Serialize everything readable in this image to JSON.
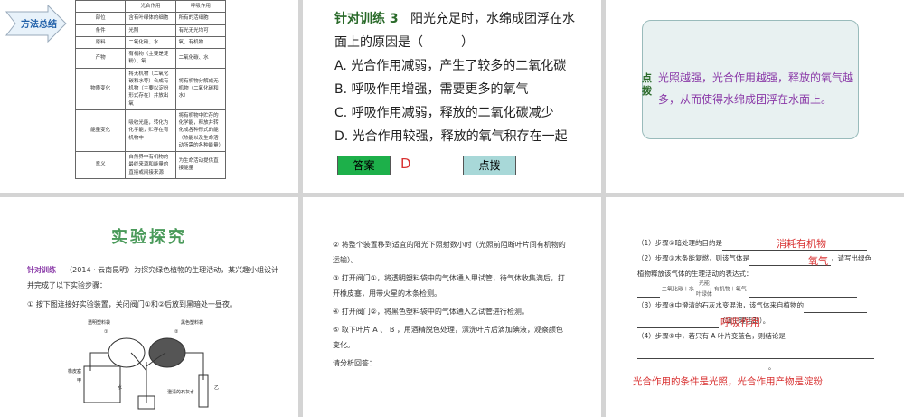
{
  "slide1": {
    "badge": "方法总结",
    "table": {
      "headers": [
        "",
        "光合作用",
        "呼吸作用"
      ],
      "rows": [
        [
          "部位",
          "含有叶绿体的细胞",
          "所有的活细胞"
        ],
        [
          "条件",
          "光照",
          "有光无光均可"
        ],
        [
          "原料",
          "二氧化碳、水",
          "氧、有机物"
        ],
        [
          "产物",
          "有机物（主要是淀粉）、氧",
          "二氧化碳、水"
        ],
        [
          "物质变化",
          "将无机物（二氧化碳和水等）合成有机物（主要以淀粉形式存在）并放出氧",
          "将有机物分解成无机物（二氧化碳和水）"
        ],
        [
          "能量变化",
          "吸收光能，转化为化学能，贮存在有机物中",
          "将有机物中贮存的化学能，释放并转化成各种形式的能（热能以及生命活动所需的各种能量）"
        ],
        [
          "意义",
          "自然界中有机物的最终来源和能量的直接或间接来源",
          "为生命活动提供直接能量"
        ]
      ]
    }
  },
  "slide2": {
    "label": "针对训练 3",
    "question": "阳光充足时，水绵成团浮在水面上的原因是（　　　）",
    "options": [
      "A. 光合作用减弱，产生了较多的二氧化碳",
      "B. 呼吸作用增强，需要更多的氧气",
      "C. 呼吸作用减弱，释放的二氧化碳减少",
      "D. 光合作用较强，释放的氧气积存在一起"
    ],
    "answer_btn": "答案",
    "answer": "D",
    "hint_btn": "点拨",
    "colors": {
      "answer_btn": "#1db04a",
      "hint_btn": "#a8d8d8",
      "answer": "#d83030"
    }
  },
  "slide3": {
    "label": "点拨",
    "text": "光照越强，光合作用越强，释放的氧气越多，从而使得水绵成团浮在水面上。"
  },
  "slide4": {
    "title": "实验探究",
    "label": "针对训练",
    "source": "（2014 · 云南昆明）为探究绿色植物的生理活动，某兴趣小组设计并完成了以下实验步骤：",
    "step1": "① 按下图连接好实验装置，关闭阀门①和②后放到黑暗处一昼夜。",
    "diagram": {
      "bag1": "透明塑料袋",
      "bag2": "黑色塑料袋",
      "stopper": "橡皮塞",
      "jia": "甲",
      "water": "水",
      "limewater": "澄清的石灰水",
      "yi": "乙",
      "valve1": "①",
      "valve2": "②"
    }
  },
  "slide5": {
    "lines": [
      "② 将整个装置移到适宜的阳光下照射数小时（光照前阻断叶片间有机物的运输）。",
      "③ 打开阀门①，将透明塑料袋中的气体通入甲试管，待气体收集满后，打开橡皮塞，用带火星的木条检测。",
      "④ 打开阀门②，将黑色塑料袋中的气体通入乙试管进行检测。",
      "⑤ 取下叶片 A 、 B ，用酒精脱色处理，漂洗叶片后滴加碘液，观察颜色变化。",
      "请分析回答："
    ]
  },
  "slide6": {
    "q1": "（1）步骤①暗处理的目的是",
    "a1": "消耗有机物",
    "q2a": "（2）步骤③木条能复燃，则该气体是",
    "a2": "氧气",
    "q2b": "，请写出绿色植物释放该气体的生理活动的表达式：",
    "eq_left": "二氧化碳＋水",
    "eq_top": "光能",
    "eq_bottom": "叶绿体",
    "eq_right": "有机物＋氧气",
    "q3a": "（3）步骤④中澄清的石灰水变混浊，该气体来自植物的",
    "a3": "呼吸作用",
    "q3b": "（填生理活动）。",
    "q4": "（4）步骤⑤中，若只有 A 叶片变蓝色，则结论是",
    "a4": "光合作用的条件是光照，光合作用产物是淀粉"
  }
}
